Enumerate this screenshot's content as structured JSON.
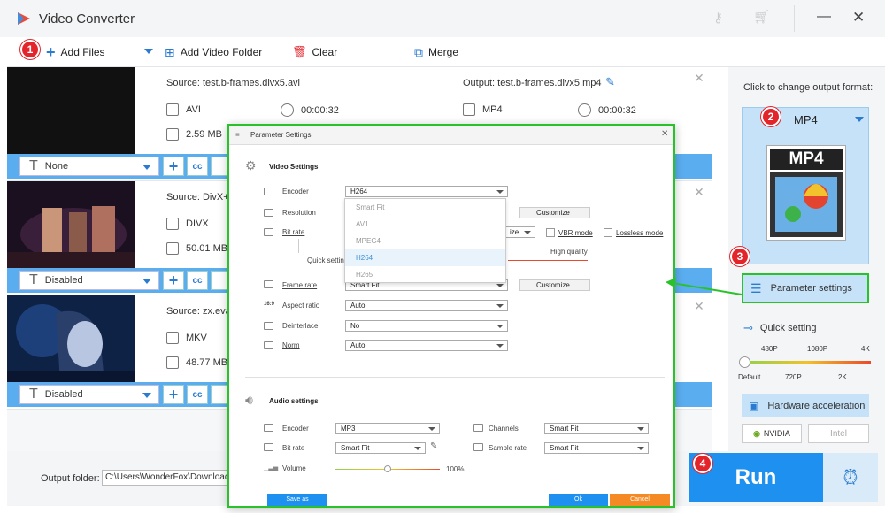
{
  "window": {
    "title": "Video Converter"
  },
  "toolbar": {
    "add_files": "Add Files",
    "add_folder": "Add Video Folder",
    "clear": "Clear",
    "merge": "Merge"
  },
  "files": [
    {
      "source": "Source: test.b-frames.divx5.avi",
      "output": "Output: test.b-frames.divx5.mp4",
      "format": "AVI",
      "duration": "00:00:32",
      "out_format": "MP4",
      "out_duration": "00:00:32",
      "size": "2.59 MB",
      "subtitle": "None"
    },
    {
      "source": "Source: DivX+",
      "format": "DIVX",
      "size": "50.01 MB",
      "subtitle": "Disabled"
    },
    {
      "source": "Source: zx.eva",
      "format": "MKV",
      "size": "48.77 MB",
      "subtitle": "Disabled"
    }
  ],
  "right_panel": {
    "click_text": "Click to change output format:",
    "format": "MP4",
    "format_art": "MP4",
    "param_settings": "Parameter settings",
    "quick_setting": "Quick setting",
    "quality_top": [
      "480P",
      "1080P",
      "4K"
    ],
    "quality_bottom": [
      "Default",
      "720P",
      "2K"
    ],
    "hw_accel": "Hardware acceleration",
    "nvidia": "NVIDIA",
    "intel": "Intel",
    "quick_level": 0
  },
  "bottom": {
    "output_folder_label": "Output folder:",
    "output_folder_value": "C:\\Users\\WonderFox\\Downloads",
    "run": "Run"
  },
  "badges": [
    "1",
    "2",
    "3",
    "4"
  ],
  "dialog": {
    "title": "Parameter Settings",
    "video_settings": "Video Settings",
    "encoder": "Encoder",
    "encoder_value": "H264",
    "resolution": "Resolution",
    "customize": "Customize",
    "bitrate": "Bit rate",
    "bitrate_btn": "ize",
    "vbr": "VBR mode",
    "lossless": "Lossless mode",
    "quick_setting": "Quick setting",
    "high_quality": "High quality",
    "frame_rate": "Frame rate",
    "frame_rate_value": "Smart Fit",
    "aspect_ratio": "Aspect ratio",
    "aspect_value": "Auto",
    "deinterlace": "Deinterlace",
    "deinterlace_value": "No",
    "norm": "Norm",
    "norm_value": "Auto",
    "encoder_options": [
      "Smart Fit",
      "AV1",
      "MPEG4",
      "H264",
      "H265"
    ],
    "selected_option": "H264",
    "audio_settings": "Audio settings",
    "a_encoder": "Encoder",
    "a_encoder_value": "MP3",
    "channels": "Channels",
    "channels_value": "Smart Fit",
    "a_bitrate": "Bit rate",
    "a_bitrate_value": "Smart Fit",
    "sample_rate": "Sample rate",
    "sample_rate_value": "Smart Fit",
    "volume": "Volume",
    "volume_value": "100%",
    "save_as": "Save as",
    "ok": "Ok",
    "cancel": "Cancel"
  },
  "colors": {
    "accent": "#1e90ef",
    "badge": "#e3242b",
    "highlight": "#2ac22a",
    "cancel": "#f58a25"
  }
}
